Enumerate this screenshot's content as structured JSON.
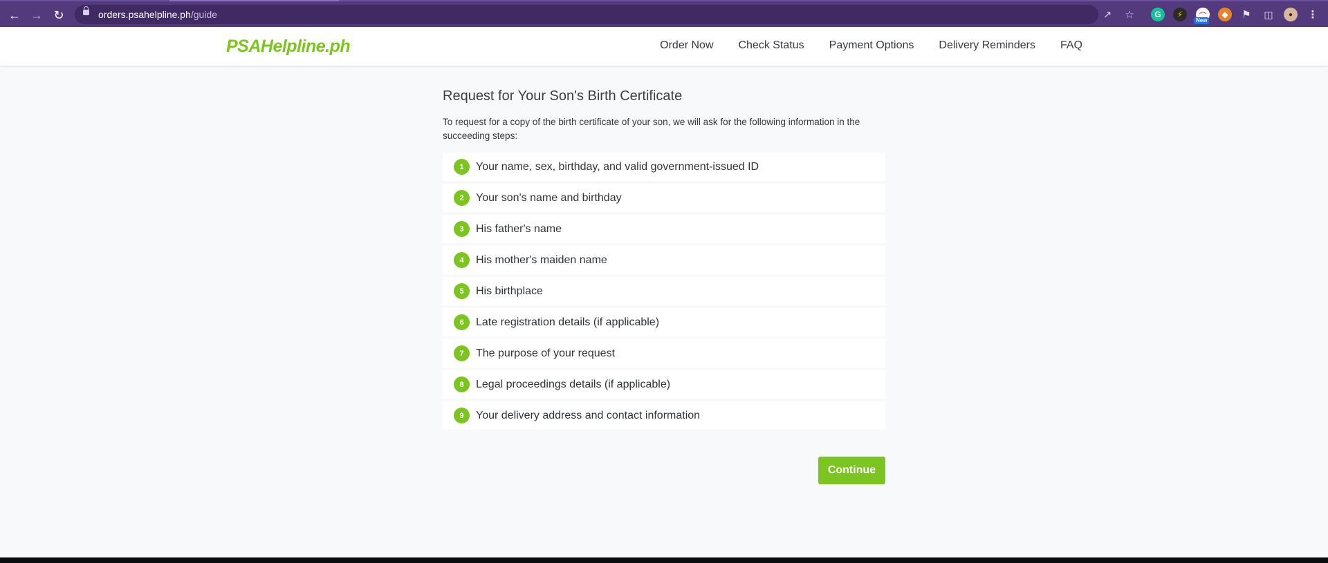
{
  "browser": {
    "url_host": "orders.psahelpline.ph",
    "url_path": "/guide",
    "back_icon": "arrow-left-icon",
    "forward_icon": "arrow-right-icon",
    "reload_icon": "reload-icon",
    "new_badge": "New"
  },
  "header": {
    "logo": "PSAHelpline.ph",
    "nav": [
      "Order Now",
      "Check Status",
      "Payment Options",
      "Delivery Reminders",
      "FAQ"
    ]
  },
  "main": {
    "title": "Request for Your Son's Birth Certificate",
    "intro": "To request for a copy of the birth certificate of your son, we will ask for the following information in the succeeding steps:",
    "steps": [
      {
        "num": "1",
        "text": "Your name, sex, birthday, and valid government-issued ID"
      },
      {
        "num": "2",
        "text": "Your son's name and birthday"
      },
      {
        "num": "3",
        "text": "His father's name"
      },
      {
        "num": "4",
        "text": "His mother's maiden name"
      },
      {
        "num": "5",
        "text": "His birthplace"
      },
      {
        "num": "6",
        "text": "Late registration details (if applicable)"
      },
      {
        "num": "7",
        "text": "The purpose of your request"
      },
      {
        "num": "8",
        "text": "Legal proceedings details (if applicable)"
      },
      {
        "num": "9",
        "text": "Your delivery address and contact information"
      }
    ],
    "continue_label": "Continue"
  },
  "colors": {
    "chrome": "#533a7d",
    "accent_green": "#7cc520",
    "page_bg": "#f8f9fb"
  }
}
